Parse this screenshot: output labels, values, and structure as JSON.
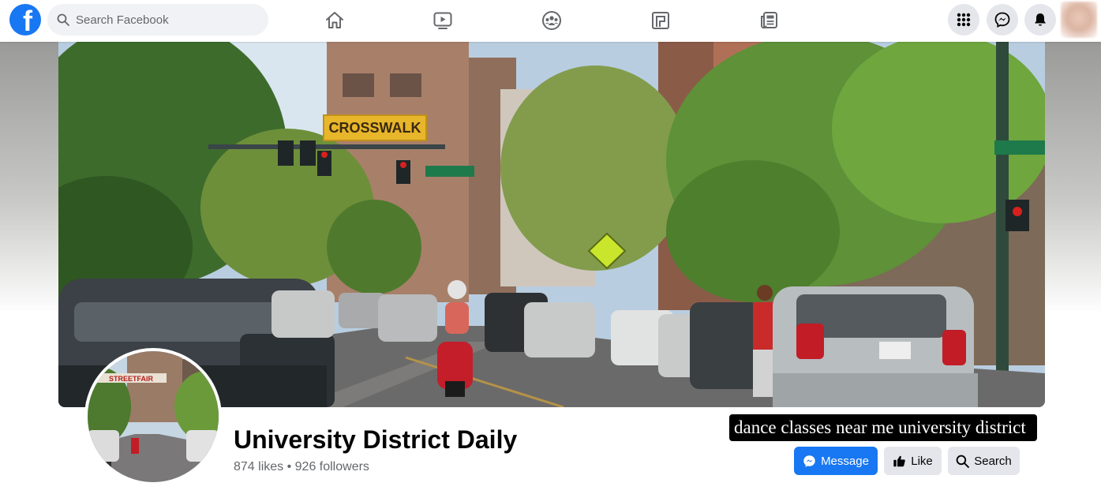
{
  "app": {
    "logo_letter": "f",
    "brand_color": "#1877f2"
  },
  "header": {
    "search_placeholder": "Search Facebook",
    "nav_tabs": [
      {
        "icon": "home-icon"
      },
      {
        "icon": "watch-icon"
      },
      {
        "icon": "groups-icon"
      },
      {
        "icon": "gaming-icon"
      },
      {
        "icon": "news-icon"
      }
    ],
    "right_buttons": [
      {
        "icon": "menu-grid-icon"
      },
      {
        "icon": "messenger-icon"
      },
      {
        "icon": "notifications-bell-icon"
      }
    ]
  },
  "cover": {
    "street_sign_text": "CROSSWALK",
    "profile_banner_text": "STREETFAIR"
  },
  "profile": {
    "name": "University District Daily",
    "stats": "874 likes • 926 followers"
  },
  "tooltip": {
    "text": "dance classes near me university district"
  },
  "actions": {
    "message_label": "Message",
    "like_label": "Like",
    "search_label": "Search"
  }
}
